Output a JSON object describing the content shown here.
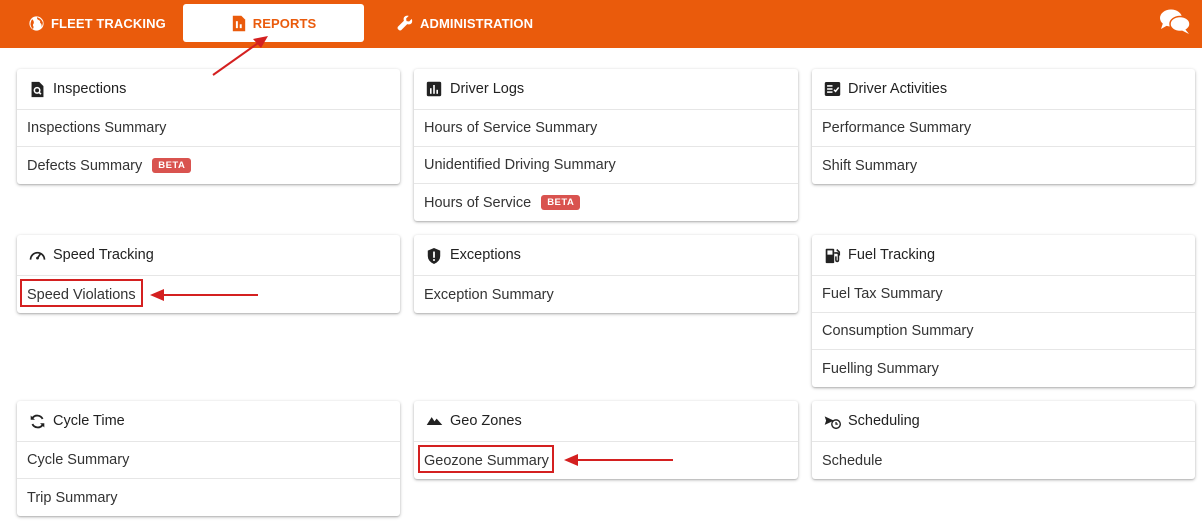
{
  "nav": {
    "fleet_label": "FLEET TRACKING",
    "reports_label": "REPORTS",
    "admin_label": "ADMINISTRATION"
  },
  "colors": {
    "brand": "#ea5b0c",
    "beta": "#d9534f",
    "annotation": "#d42020"
  },
  "cards": {
    "inspections": {
      "title": "Inspections",
      "items": [
        "Inspections Summary",
        "Defects Summary"
      ],
      "icon": "magnifier-doc-icon"
    },
    "driver_logs": {
      "title": "Driver Logs",
      "items": [
        "Hours of Service Summary",
        "Unidentified Driving Summary",
        "Hours of Service"
      ],
      "icon": "bar-chart-icon"
    },
    "driver_activities": {
      "title": "Driver Activities",
      "items": [
        "Performance Summary",
        "Shift Summary"
      ],
      "icon": "checklist-icon"
    },
    "speed_tracking": {
      "title": "Speed Tracking",
      "items": [
        "Speed Violations"
      ],
      "icon": "speedometer-icon"
    },
    "exceptions": {
      "title": "Exceptions",
      "items": [
        "Exception Summary"
      ],
      "icon": "shield-alert-icon"
    },
    "fuel_tracking": {
      "title": "Fuel Tracking",
      "items": [
        "Fuel Tax Summary",
        "Consumption Summary",
        "Fuelling Summary"
      ],
      "icon": "fuel-pump-icon"
    },
    "cycle_time": {
      "title": "Cycle Time",
      "items": [
        "Cycle Summary",
        "Trip Summary"
      ],
      "icon": "cycle-icon"
    },
    "geo_zones": {
      "title": "Geo Zones",
      "items": [
        "Geozone Summary"
      ],
      "icon": "mountains-icon"
    },
    "scheduling": {
      "title": "Scheduling",
      "items": [
        "Schedule"
      ],
      "icon": "scheduling-icon"
    }
  },
  "badges": {
    "beta": "BETA"
  }
}
